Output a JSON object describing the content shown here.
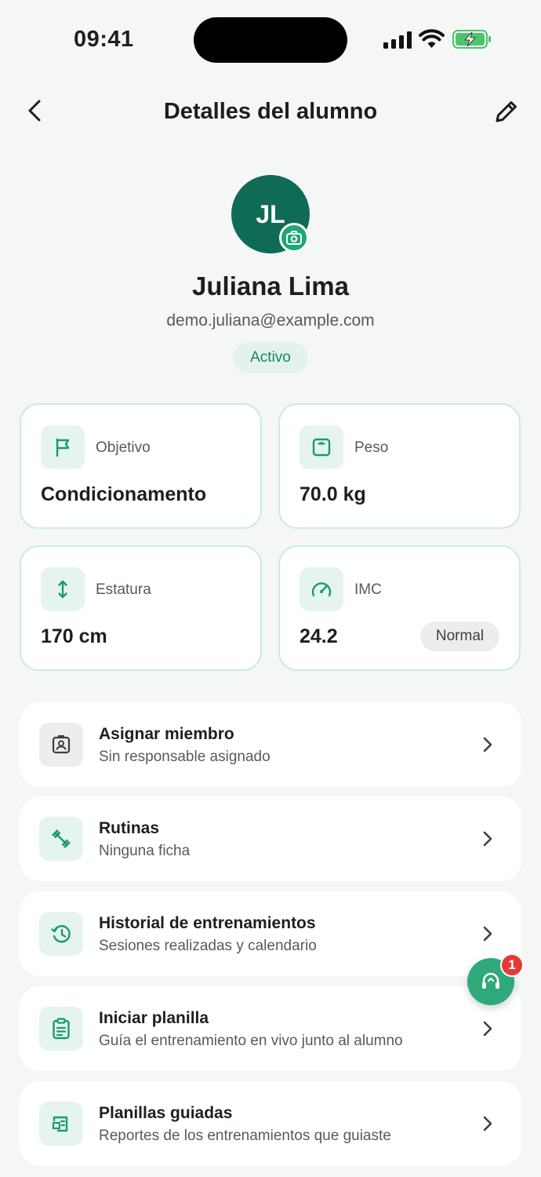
{
  "status_bar": {
    "time": "09:41"
  },
  "nav": {
    "title": "Detalles del alumno"
  },
  "profile": {
    "initials": "JL",
    "name": "Juliana Lima",
    "email": "demo.juliana@example.com",
    "status": "Activo"
  },
  "stats": [
    {
      "label": "Objetivo",
      "value": "Condicionamento",
      "icon": "flag-icon"
    },
    {
      "label": "Peso",
      "value": "70.0 kg",
      "icon": "scale-icon"
    },
    {
      "label": "Estatura",
      "value": "170 cm",
      "icon": "vertical-arrows-icon"
    },
    {
      "label": "IMC",
      "value": "24.2",
      "icon": "gauge-icon",
      "badge": "Normal"
    }
  ],
  "menu": [
    {
      "title": "Asignar miembro",
      "subtitle": "Sin responsable asignado",
      "icon": "id-badge-icon"
    },
    {
      "title": "Rutinas",
      "subtitle": "Ninguna ficha",
      "icon": "dumbbell-icon"
    },
    {
      "title": "Historial de entrenamientos",
      "subtitle": "Sesiones realizadas y calendario",
      "icon": "history-icon"
    },
    {
      "title": "Iniciar planilla",
      "subtitle": "Guía el entrenamiento en vivo junto al alumno",
      "icon": "clipboard-icon"
    },
    {
      "title": "Planillas guiadas",
      "subtitle": "Reportes de los entrenamientos que guiaste",
      "icon": "guided-sheet-icon"
    }
  ],
  "support": {
    "badge_count": "1",
    "icon": "headset-icon"
  },
  "colors": {
    "accent": "#1ea874",
    "avatar": "#0f6b56",
    "card_border": "#cfeadf",
    "badge": "#e53935"
  }
}
